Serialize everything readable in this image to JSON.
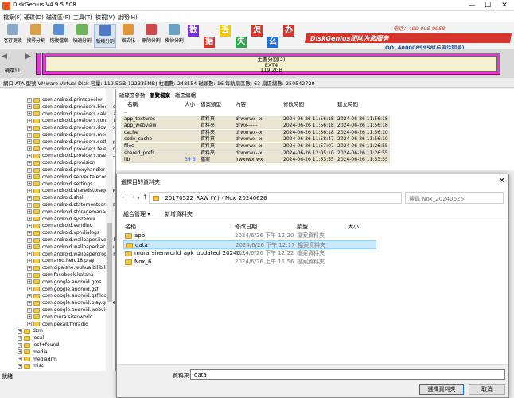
{
  "app": {
    "title": "DiskGenius V4.9.5.508"
  },
  "window_controls": {
    "minimize": "—",
    "maximize": "☐",
    "close": "✕"
  },
  "menu": [
    "檔案(F)",
    "硬碟(D)",
    "磁碟區(P)",
    "工具(T)",
    "檢視(V)",
    "說明(H)"
  ],
  "toolbar": [
    {
      "label": "客存更改",
      "color": "#8aa9c9"
    },
    {
      "label": "搜尋分割",
      "color": "#d8a24a"
    },
    {
      "label": "恢復檔案",
      "color": "#5c8fcf"
    },
    {
      "label": "快速分割",
      "color": "#6fb35a"
    },
    {
      "label": "新增分割",
      "color": "#4f79c7"
    },
    {
      "label": "格式化",
      "color": "#e0973b"
    },
    {
      "label": "刪除分割",
      "color": "#cf4a4a"
    },
    {
      "label": "備份分割",
      "color": "#6aa2c4"
    }
  ],
  "banner": {
    "chars": [
      "数",
      "据",
      "丢",
      "失",
      "怎",
      "么",
      "办"
    ],
    "brand": "DiskGenius团队为您服务",
    "phone": "电话：400-008-9958",
    "qq": "QQ: 4000089958(与电话同号)"
  },
  "disk_nav": {
    "label": "硬碟11"
  },
  "partition": {
    "name": "主要分割(2)",
    "fs": "EXT4",
    "size": "119.2GB"
  },
  "info_line": "網口:ATA 型號:VMware Virtual Disk 容量: 119.5GB(122335MB) 柱面數: 248554 磁頭數: 16 每軌扇區數: 63 扇區總數: 250542720",
  "tree": {
    "items": [
      "com.android.printspooler",
      "com.android.providers.blocked",
      "com.android.providers.calendar",
      "com.android.providers.contacts",
      "com.android.providers.downloa",
      "com.android.providers.media",
      "com.android.providers.settings",
      "com.android.providers.telephon",
      "com.android.providers.userdicti",
      "com.android.provision",
      "com.android.proxyhandler",
      "com.android.server.telecom",
      "com.android.settings",
      "com.android.sharedstoragebacku",
      "com.android.shell",
      "com.android.statementservice",
      "com.android.storagemanager",
      "com.android.systemui",
      "com.android.vending",
      "com.android.vpndialogs",
      "com.android.wallpaper.livepick",
      "com.android.wallpaperbackup",
      "com.android.wallpapercropper",
      "com.amd.hero18.play",
      "com.cipaishe.wuhua.bilibili",
      "com.facebook.katana",
      "com.google.android.gms",
      "com.google.android.gsf",
      "com.google.android.gsf.login",
      "com.google.android.play.games",
      "com.google.android.webview",
      "com.mura.sirenworld",
      "com.pekall.fmradio",
      "dzm",
      "local",
      "lost+found",
      "media",
      "mediadrm",
      "misc"
    ]
  },
  "status": {
    "text": "就緒"
  },
  "file_panel": {
    "tabs": [
      "磁碟區參數",
      "瀏覽檔案",
      "磁區編輯"
    ],
    "headers": [
      "名稱",
      "大小",
      "檔案類型",
      "內容",
      "修改時間",
      "建立時間"
    ],
    "rows": [
      {
        "name": "..",
        "size": "",
        "type": "",
        "attr": "",
        "mtime": "",
        "ctime": ""
      },
      {
        "name": "app_textures",
        "size": "",
        "type": "資料夾",
        "attr": "drwxrwx--x",
        "mtime": "2024-06-26 11:56:18",
        "ctime": "2024-06-26 11:56:18"
      },
      {
        "name": "app_webview",
        "size": "",
        "type": "資料夾",
        "attr": "drwx------",
        "mtime": "2024-06-26 11:56:18",
        "ctime": "2024-06-26 11:56:18"
      },
      {
        "name": "cache",
        "size": "",
        "type": "資料夾",
        "attr": "drwxrwx--x",
        "mtime": "2024-06-26 11:56:18",
        "ctime": "2024-06-26 11:56:10"
      },
      {
        "name": "code_cache",
        "size": "",
        "type": "資料夾",
        "attr": "drwxrwx--x",
        "mtime": "2024-06-26 11:58:47",
        "ctime": "2024-06-26 11:56:10"
      },
      {
        "name": "files",
        "size": "",
        "type": "資料夾",
        "attr": "drwxrwx--x",
        "mtime": "2024-06-26 11:57:07",
        "ctime": "2024-06-26 11:26:55"
      },
      {
        "name": "shared_prefs",
        "size": "",
        "type": "資料夾",
        "attr": "drwxrwx--x",
        "mtime": "2024-06-26 12:05:10",
        "ctime": "2024-06-26 11:26:55"
      },
      {
        "name": "lib",
        "size": "39 B",
        "type": "檔案",
        "attr": "lrwxrwxrwx",
        "mtime": "2024-06-26 11:53:55",
        "ctime": "2024-06-26 11:53:55"
      }
    ]
  },
  "dialog": {
    "title": "選擇目的資料夾",
    "close": "✕",
    "nav": {
      "back": "←",
      "forward": "→",
      "up": "↑",
      "recent": "▾"
    },
    "breadcrumb": [
      "20170522_RAW (Y:)",
      "Nox_20240626"
    ],
    "search_placeholder": "搜尋 Nox_20240626",
    "organize": "組合管理 ▾",
    "new_folder": "新增資料夾",
    "columns": [
      "名稱",
      "修改日期",
      "類型",
      "大小"
    ],
    "rows": [
      {
        "name": "app",
        "date": "2024/6/26 下午 12:20",
        "type": "檔案資料夾",
        "selected": false
      },
      {
        "name": "data",
        "date": "2024/6/26 下午 12:17",
        "type": "檔案資料夾",
        "selected": true
      },
      {
        "name": "mura_sirenworld_apk_updated_20240...",
        "date": "2024/6/26 下午 12:22",
        "type": "檔案資料夾",
        "selected": false
      },
      {
        "name": "Nox_6",
        "date": "2024/6/26 上午 11:56",
        "type": "檔案資料夾",
        "selected": false
      }
    ],
    "filename_label": "資料夾:",
    "filename_value": "data",
    "ok": "選擇資料夾",
    "cancel": "取消"
  }
}
